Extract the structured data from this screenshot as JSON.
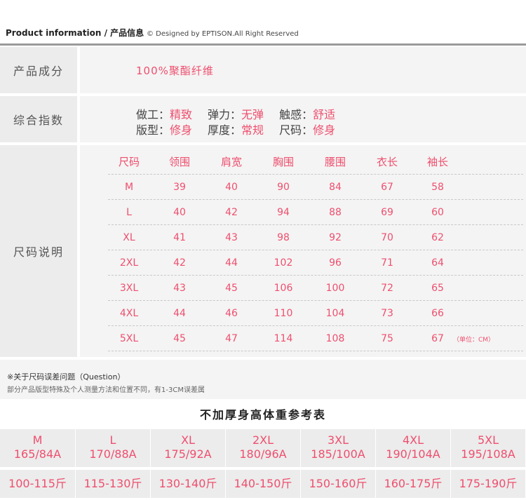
{
  "header": {
    "title_en": "Product information",
    "separator": " / ",
    "title_cn": "产品信息",
    "copyright": "© Designed by EPTISON.All Right Reserved"
  },
  "composition": {
    "label": "产品成分",
    "value": "100%聚酯纤维"
  },
  "index": {
    "label": "综合指数",
    "line1": [
      {
        "key": "做工：",
        "value": "精致"
      },
      {
        "key": "弹力：",
        "value": "无弹"
      },
      {
        "key": "触感：",
        "value": "舒适"
      }
    ],
    "line2": [
      {
        "key": "版型：",
        "value": "修身"
      },
      {
        "key": "厚度：",
        "value": "常规"
      },
      {
        "key": "尺码：",
        "value": "修身"
      }
    ]
  },
  "size_chart": {
    "label": "尺码说明",
    "columns": [
      "尺码",
      "领围",
      "肩宽",
      "胸围",
      "腰围",
      "衣长",
      "袖长"
    ],
    "rows": [
      [
        "M",
        "39",
        "40",
        "90",
        "84",
        "67",
        "58"
      ],
      [
        "L",
        "40",
        "42",
        "94",
        "88",
        "69",
        "60"
      ],
      [
        "XL",
        "41",
        "43",
        "98",
        "92",
        "70",
        "62"
      ],
      [
        "2XL",
        "42",
        "44",
        "102",
        "96",
        "71",
        "64"
      ],
      [
        "3XL",
        "43",
        "45",
        "106",
        "100",
        "72",
        "65"
      ],
      [
        "4XL",
        "44",
        "46",
        "110",
        "104",
        "73",
        "66"
      ],
      [
        "5XL",
        "45",
        "47",
        "114",
        "108",
        "75",
        "67"
      ]
    ],
    "unit_note": "（单位：CM）"
  },
  "question": {
    "title": "※关于尺码误差问题（Question）",
    "description": "部分产品版型特殊及个人测量方法和位置不同，有1-3CM误差属"
  },
  "reference": {
    "title": "不加厚身高体重参考表",
    "sizes": [
      {
        "size": "M",
        "height": "165/84A",
        "weight": "100-115斤"
      },
      {
        "size": "L",
        "height": "170/88A",
        "weight": "115-130斤"
      },
      {
        "size": "XL",
        "height": "175/92A",
        "weight": "130-140斤"
      },
      {
        "size": "2XL",
        "height": "180/96A",
        "weight": "140-150斤"
      },
      {
        "size": "3XL",
        "height": "185/100A",
        "weight": "150-160斤"
      },
      {
        "size": "4XL",
        "height": "190/104A",
        "weight": "160-175斤"
      },
      {
        "size": "5XL",
        "height": "195/108A",
        "weight": "175-190斤"
      }
    ]
  }
}
